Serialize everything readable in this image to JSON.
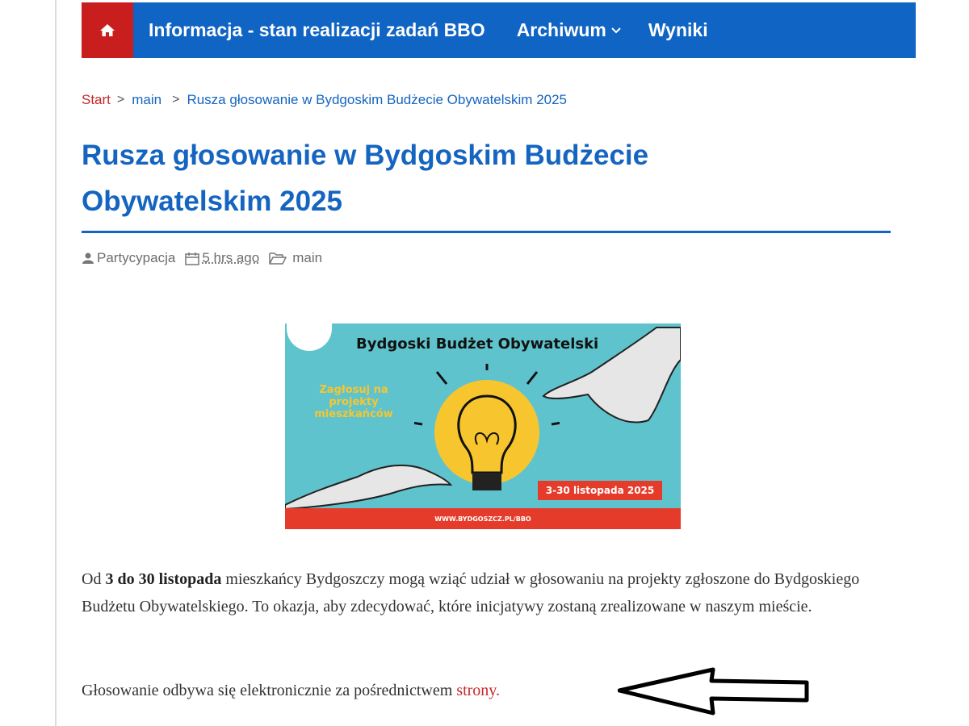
{
  "nav": {
    "home_icon": "home-icon",
    "items": [
      {
        "label": "Informacja - stan realizacji zadań BBO"
      },
      {
        "label": "Archiwum"
      },
      {
        "label": "Wyniki"
      }
    ]
  },
  "breadcrumb": {
    "start": "Start",
    "sep": ">",
    "middle": "main",
    "current": "Rusza głosowanie w Bydgoskim Budżecie Obywatelskim 2025"
  },
  "article": {
    "title": "Rusza głosowanie w Bydgoskim Budżecie Obywatelskim 2025",
    "meta": {
      "author": "Partycypacja",
      "date": "5 hrs ago",
      "category": "main"
    },
    "banner": {
      "title": "Bydgoski Budżet Obywatelski",
      "subtitle": "Zagłosuj na projekty mieszkańców",
      "dates": "3-30 listopada 2025",
      "url": "WWW.BYDGOSZCZ.PL/BBO"
    },
    "p1": {
      "prefix": "Od ",
      "bold": "3 do 30 listopada",
      "suffix": " mieszkańcy Bydgoszczy mogą wziąć udział w głosowaniu na projekty zgłoszone do Bydgoskiego Budżetu Obywatelskiego. To okazja, aby zdecydować, które inicjatywy zostaną zrealizowane w naszym mieście."
    },
    "p2": {
      "text": "Głosowanie odbywa się elektronicznie za pośrednictwem ",
      "link": "strony."
    }
  },
  "colors": {
    "nav_blue": "#0f64c4",
    "home_red": "#c91e1e",
    "title_blue": "#1565c0",
    "link_red": "#c62828",
    "banner_teal": "#5fc3cd",
    "banner_red": "#e53b2a",
    "bulb_yellow": "#f7c62e"
  }
}
